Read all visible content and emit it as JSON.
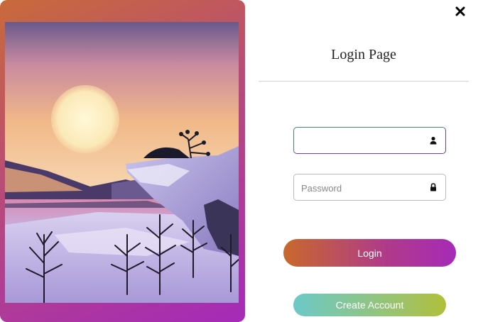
{
  "page": {
    "title": "Login Page",
    "close_icon": "close-icon"
  },
  "form": {
    "username": {
      "value": "",
      "placeholder": "",
      "icon": "user-icon"
    },
    "password": {
      "value": "",
      "placeholder": "Password",
      "icon": "lock-icon"
    },
    "login_label": "Login",
    "create_account_label": "Create Account"
  },
  "colors": {
    "login_gradient": [
      "#c8682c",
      "#a52ab8"
    ],
    "create_gradient": [
      "#6cc9c9",
      "#b0bf3a"
    ],
    "card_gradient": [
      "#c96a3a",
      "#a52ab8"
    ]
  }
}
